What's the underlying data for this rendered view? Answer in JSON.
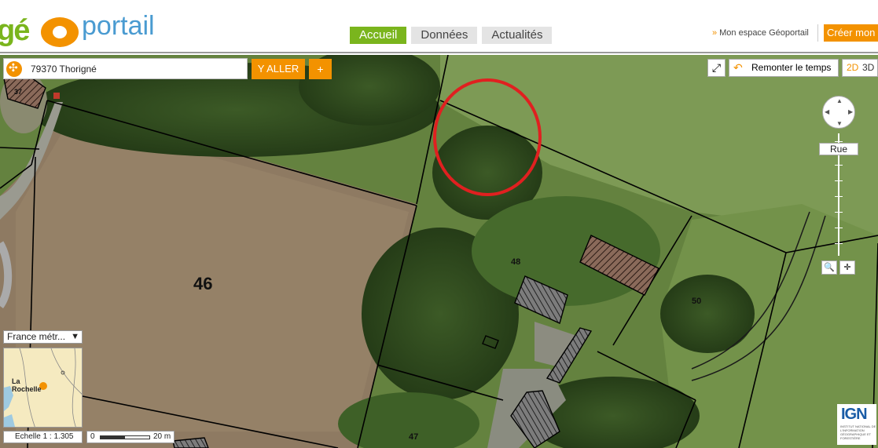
{
  "header": {
    "logo_ge": "gé",
    "logo_portail": "portail",
    "tabs": [
      {
        "label": "Accueil",
        "active": true
      },
      {
        "label": "Données",
        "active": false
      },
      {
        "label": "Actualités",
        "active": false
      }
    ],
    "espace_label": "Mon espace Géoportail",
    "creer_label": "Créer mon"
  },
  "search": {
    "value": "79370 Thorigné",
    "go_label": "Y ALLER",
    "plus_label": "+"
  },
  "map_controls": {
    "remonter_label": "Remonter le temps",
    "mode_2d": "2D",
    "mode_3d": "3D",
    "zoom_level_label": "Rue"
  },
  "parcels": {
    "p46": "46",
    "p48": "48",
    "p50": "50",
    "p47": "47",
    "p37": "37"
  },
  "overview": {
    "region_select": "France métr...",
    "city_label": "La Rochelle"
  },
  "scale": {
    "echelle_text": "Echelle 1 : 1.305",
    "bar_zero": "0",
    "bar_dist": "20 m"
  },
  "ign": {
    "logo": "IGN",
    "subtitle": "INSTITUT NATIONAL DE L'INFORMATION GÉOGRAPHIQUE ET FORESTIÈRE"
  },
  "colors": {
    "accent_orange": "#f39200",
    "accent_green": "#7ab51d",
    "highlight_circle": "#e02020"
  }
}
